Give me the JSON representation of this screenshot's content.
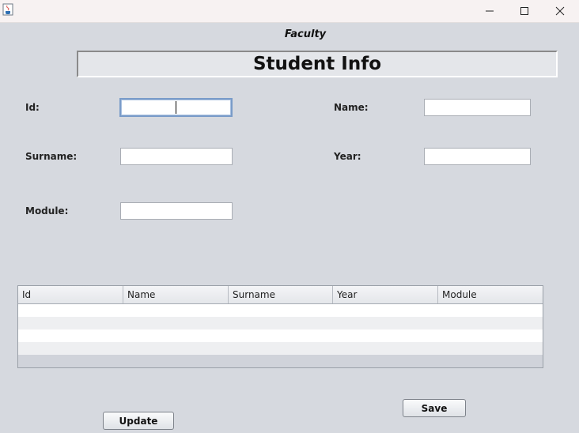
{
  "titlebar": {
    "app_icon": "java-cup-icon",
    "minimize_icon": "minimize-icon",
    "maximize_icon": "maximize-icon",
    "close_icon": "close-icon"
  },
  "header": {
    "subtitle": "Faculty",
    "title": "Student Info"
  },
  "form": {
    "id_label": "Id:",
    "id_value": "",
    "name_label": "Name:",
    "name_value": "",
    "surname_label": "Surname:",
    "surname_value": "",
    "year_label": "Year:",
    "year_value": "",
    "module_label": "Module:",
    "module_value": ""
  },
  "table": {
    "columns": [
      "Id",
      "Name",
      "Surname",
      "Year",
      "Module"
    ],
    "rows": []
  },
  "buttons": {
    "save": "Save",
    "update": "Update"
  },
  "colors": {
    "background": "#d6d9df",
    "focus_border": "#7a9cc9"
  }
}
